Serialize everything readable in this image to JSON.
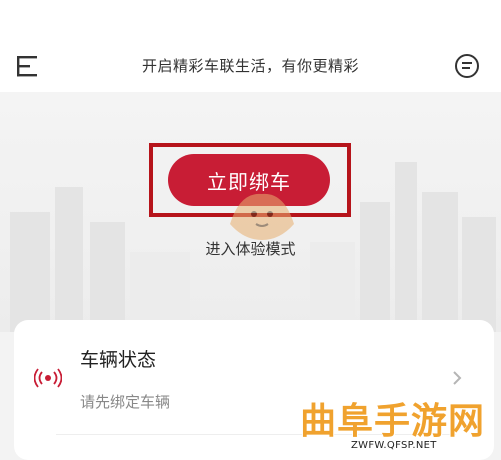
{
  "header": {
    "title": "开启精彩车联生活，有你更精彩",
    "menu_icon": "menu-icon",
    "message_icon": "message-icon"
  },
  "hero": {
    "bind_button_label": "立即绑车",
    "experience_label": "进入体验模式"
  },
  "vehicle_status": {
    "title": "车辆状态",
    "subtitle": "请先绑定车辆",
    "icon": "signal-icon",
    "chevron": "chevron-right-icon"
  },
  "watermark": {
    "title": "曲阜手游网",
    "url": "ZWFW.QFSP.NET"
  },
  "colors": {
    "accent": "#c81d35",
    "highlight": "#b6141b",
    "watermark": "#f0a22e"
  }
}
